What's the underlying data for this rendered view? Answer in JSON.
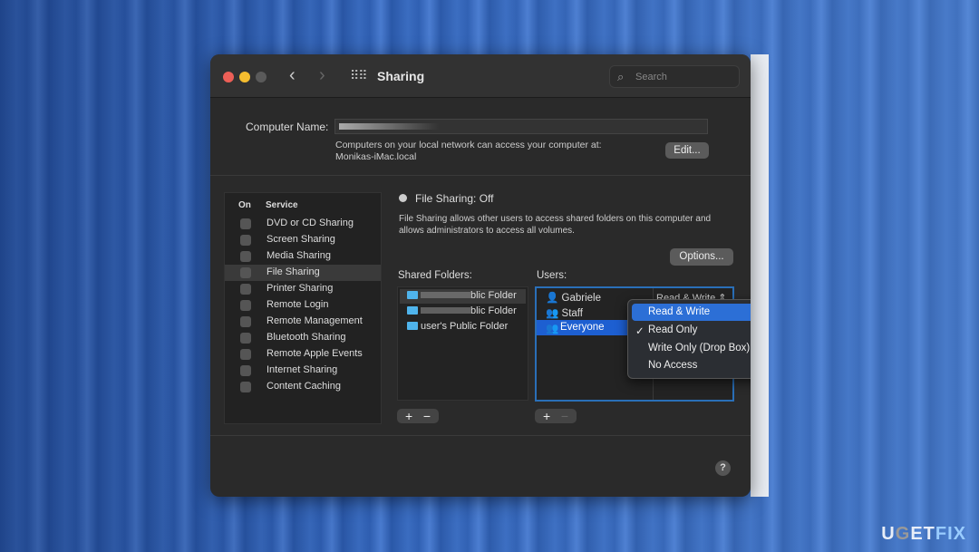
{
  "window": {
    "title": "Sharing",
    "search_placeholder": "Search"
  },
  "computer_name": {
    "label": "Computer Name:",
    "value": "",
    "info": "Computers on your local network can access your computer at:",
    "hostname": "Monikas-iMac.local",
    "edit_label": "Edit..."
  },
  "services": {
    "header_on": "On",
    "header_service": "Service",
    "items": [
      {
        "label": "DVD or CD Sharing",
        "on": false
      },
      {
        "label": "Screen Sharing",
        "on": false
      },
      {
        "label": "Media Sharing",
        "on": false
      },
      {
        "label": "File Sharing",
        "on": false,
        "selected": true
      },
      {
        "label": "Printer Sharing",
        "on": false
      },
      {
        "label": "Remote Login",
        "on": false
      },
      {
        "label": "Remote Management",
        "on": false
      },
      {
        "label": "Bluetooth Sharing",
        "on": false
      },
      {
        "label": "Remote Apple Events",
        "on": false
      },
      {
        "label": "Internet Sharing",
        "on": false
      },
      {
        "label": "Content Caching",
        "on": false
      }
    ]
  },
  "file_sharing": {
    "status": "File Sharing: Off",
    "description": "File Sharing allows other users to access shared folders on this computer and allows administrators to access all volumes.",
    "options_label": "Options..."
  },
  "shared_folders": {
    "label": "Shared Folders:",
    "items": [
      "blic Folder",
      "blic Folder",
      "user's Public Folder"
    ]
  },
  "users": {
    "label": "Users:",
    "items": [
      {
        "name": "Gabriele",
        "permission": "Read & Write",
        "icon": "user-icon"
      },
      {
        "name": "Staff",
        "icon": "group-icon"
      },
      {
        "name": "Everyone",
        "icon": "group-icon",
        "selected": true
      }
    ]
  },
  "permission_menu": {
    "items": [
      "Read & Write",
      "Read Only",
      "Write Only (Drop Box)",
      "No Access"
    ],
    "checked": "Read Only",
    "highlighted": "Read & Write"
  },
  "buttons": {
    "add": "+",
    "remove": "−",
    "help": "?"
  },
  "brand": "UGETFIX",
  "colors": {
    "accent": "#1d5fd1",
    "close": "#ed5f57",
    "minimize": "#f5bd2f",
    "folder": "#4fb4ec"
  }
}
